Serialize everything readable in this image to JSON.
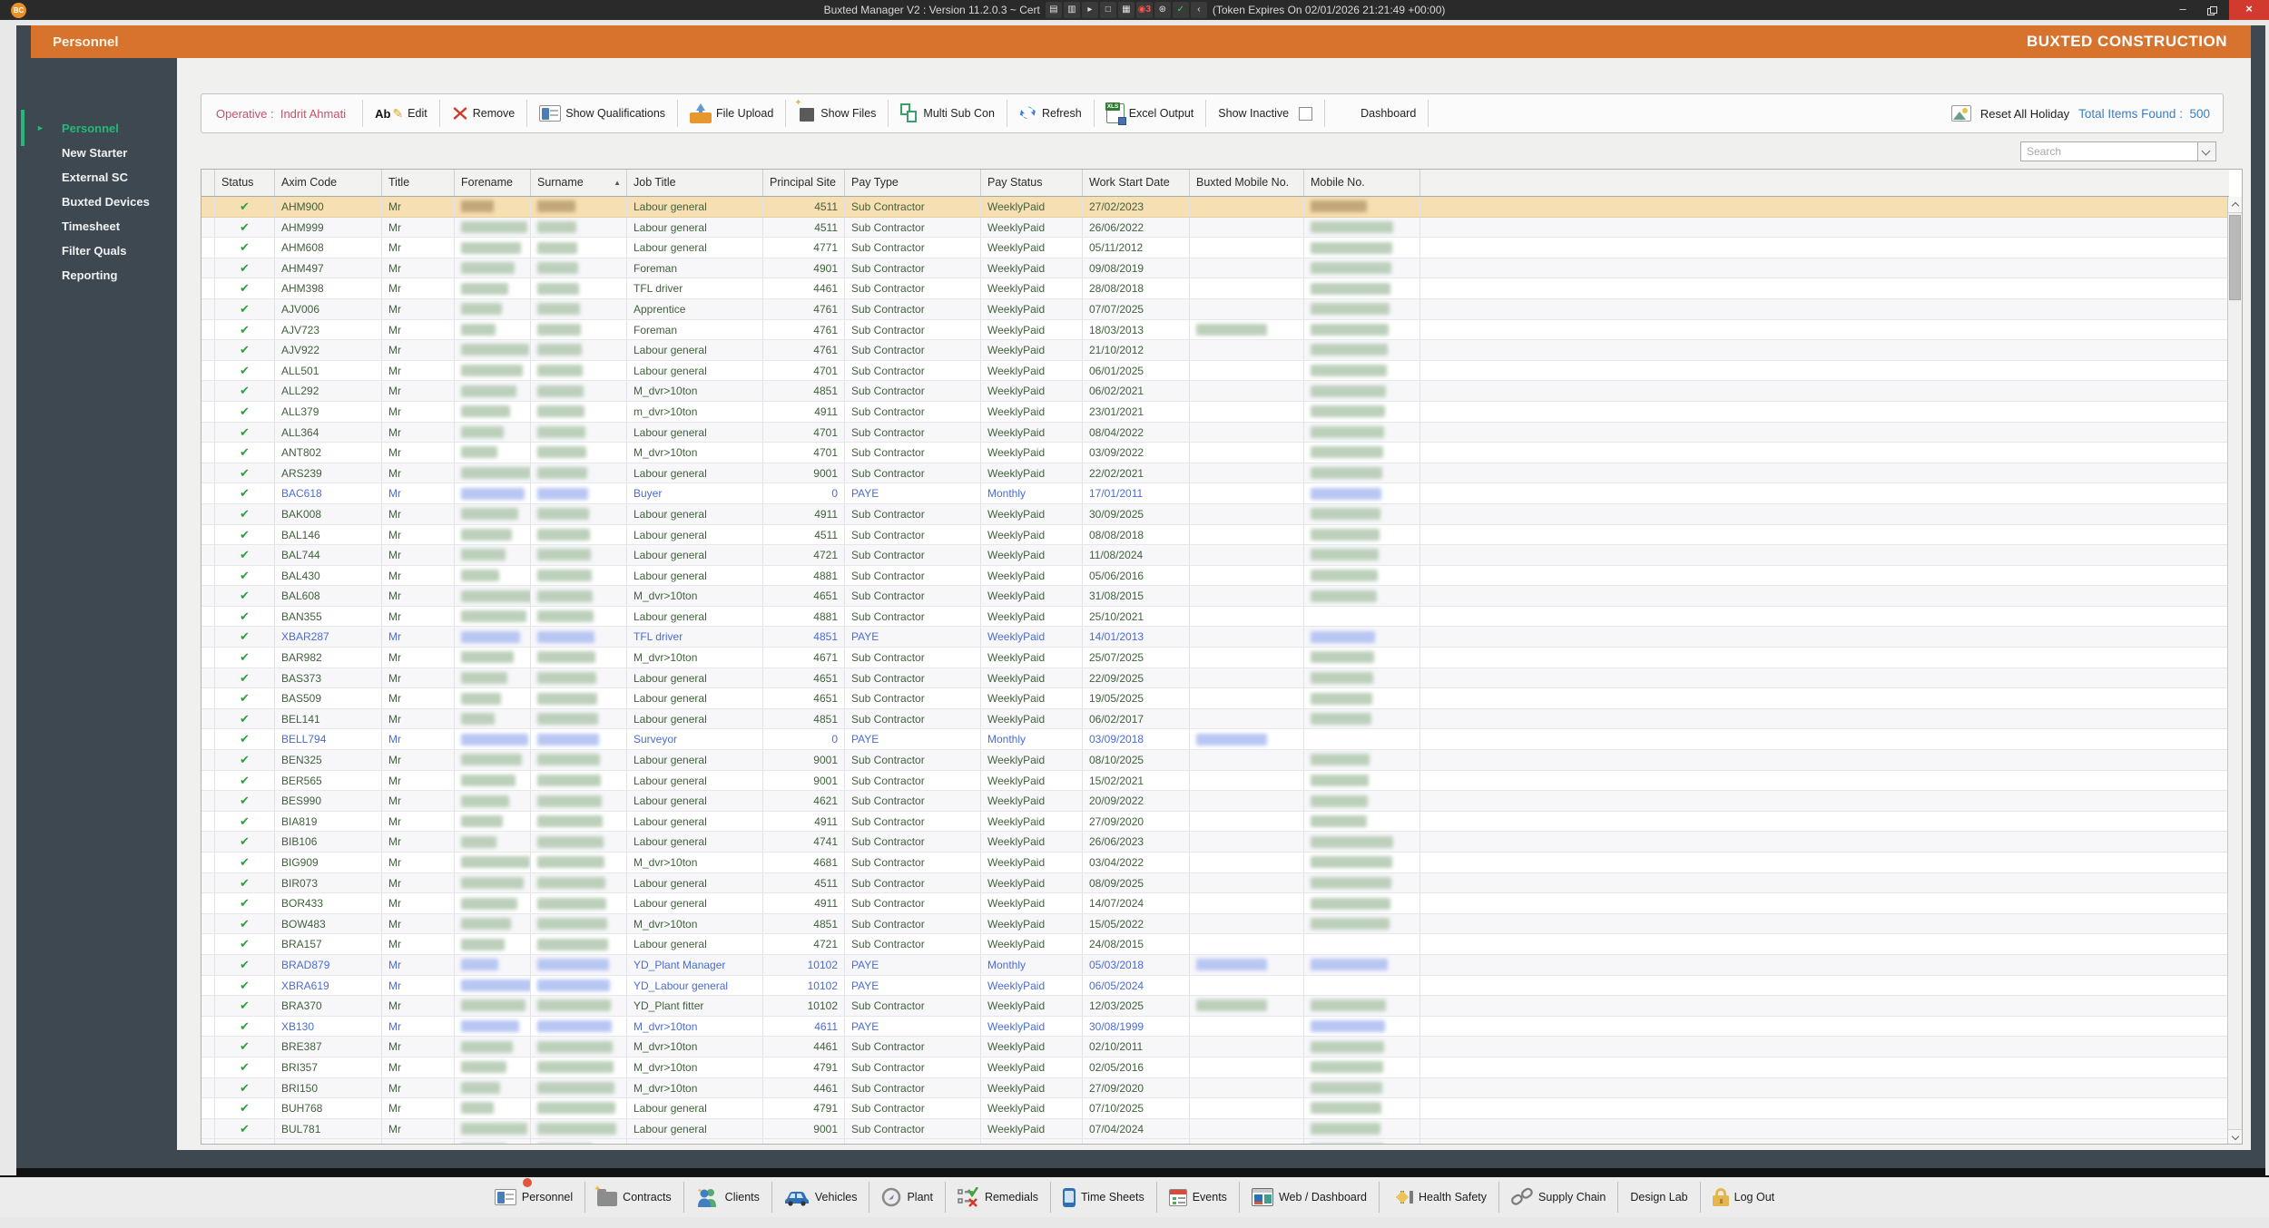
{
  "titlebar": {
    "logo": "BC",
    "title_left": "Buxted Manager V2 : Version 11.2.0.3 ~ Cert",
    "title_right": "(Token Expires On 02/01/2026 21:21:49 +00:00)",
    "tray_icons": [
      "cast-icon",
      "camera-icon",
      "cursor-icon",
      "window-icon",
      "layers-icon",
      "record-count-3-icon",
      "accessibility-icon",
      "shield-check-icon",
      "collapse-arrow-icon"
    ],
    "window_controls": {
      "minimize": "–",
      "restore": "",
      "close": "×"
    }
  },
  "header": {
    "page_title": "Personnel",
    "brand": "BUXTED CONSTRUCTION"
  },
  "sidebar": {
    "items": [
      {
        "label": "Personnel",
        "active": true
      },
      {
        "label": "New Starter",
        "active": false
      },
      {
        "label": "External SC",
        "active": false
      },
      {
        "label": "Buxted Devices",
        "active": false
      },
      {
        "label": "Timesheet",
        "active": false
      },
      {
        "label": "Filter Quals",
        "active": false
      },
      {
        "label": "Reporting",
        "active": false
      }
    ]
  },
  "toolbar": {
    "operative_label": "Operative :",
    "operative_name": "Indrit Ahmati",
    "edit_label": "Edit",
    "remove_label": "Remove",
    "show_qualifications_label": "Show Qualifications",
    "file_upload_label": "File Upload",
    "show_files_label": "Show Files",
    "multi_sub_con_label": "Multi Sub Con",
    "refresh_label": "Refresh",
    "excel_output_label": "Excel Output",
    "show_inactive_label": "Show Inactive",
    "show_inactive_checked": false,
    "dashboard_label": "Dashboard",
    "reset_all_holiday_label": "Reset All Holiday",
    "total_items_label": "Total Items Found :",
    "total_items_value": "500"
  },
  "search": {
    "placeholder": "Search"
  },
  "grid": {
    "columns": [
      {
        "label": ""
      },
      {
        "label": "Status"
      },
      {
        "label": "Axim Code"
      },
      {
        "label": "Title"
      },
      {
        "label": "Forename"
      },
      {
        "label": "Surname",
        "sorted": "asc"
      },
      {
        "label": "Job Title"
      },
      {
        "label": "Principal Site"
      },
      {
        "label": "Pay Type"
      },
      {
        "label": "Pay Status"
      },
      {
        "label": "Work Start Date"
      },
      {
        "label": "Buxted Mobile No."
      },
      {
        "label": "Mobile No."
      }
    ],
    "rows": [
      {
        "axim": "AHM900",
        "title": "Mr",
        "job": "Labour general",
        "site": "4511",
        "pay_type": "Sub Contractor",
        "pay_status": "WeeklyPaid",
        "date": "27/02/2023",
        "buxted_redacted": false,
        "mobile_redacted": true,
        "selected": true
      },
      {
        "axim": "AHM999",
        "title": "Mr",
        "job": "Labour general",
        "site": "4511",
        "pay_type": "Sub Contractor",
        "pay_status": "WeeklyPaid",
        "date": "26/06/2022",
        "buxted_redacted": false,
        "mobile_redacted": true
      },
      {
        "axim": "AHM608",
        "title": "Mr",
        "job": "Labour general",
        "site": "4771",
        "pay_type": "Sub Contractor",
        "pay_status": "WeeklyPaid",
        "date": "05/11/2012",
        "buxted_redacted": false,
        "mobile_redacted": true
      },
      {
        "axim": "AHM497",
        "title": "Mr",
        "job": "Foreman",
        "site": "4901",
        "pay_type": "Sub Contractor",
        "pay_status": "WeeklyPaid",
        "date": "09/08/2019",
        "buxted_redacted": false,
        "mobile_redacted": true
      },
      {
        "axim": "AHM398",
        "title": "Mr",
        "job": "TFL driver",
        "site": "4461",
        "pay_type": "Sub Contractor",
        "pay_status": "WeeklyPaid",
        "date": "28/08/2018",
        "buxted_redacted": false,
        "mobile_redacted": true
      },
      {
        "axim": "AJV006",
        "title": "Mr",
        "job": "Apprentice",
        "site": "4761",
        "pay_type": "Sub Contractor",
        "pay_status": "WeeklyPaid",
        "date": "07/07/2025",
        "buxted_redacted": false,
        "mobile_redacted": true
      },
      {
        "axim": "AJV723",
        "title": "Mr",
        "job": "Foreman",
        "site": "4761",
        "pay_type": "Sub Contractor",
        "pay_status": "WeeklyPaid",
        "date": "18/03/2013",
        "buxted_redacted": true,
        "mobile_redacted": true
      },
      {
        "axim": "AJV922",
        "title": "Mr",
        "job": "Labour general",
        "site": "4761",
        "pay_type": "Sub Contractor",
        "pay_status": "WeeklyPaid",
        "date": "21/10/2012",
        "buxted_redacted": false,
        "mobile_redacted": true
      },
      {
        "axim": "ALL501",
        "title": "Mr",
        "job": "Labour general",
        "site": "4701",
        "pay_type": "Sub Contractor",
        "pay_status": "WeeklyPaid",
        "date": "06/01/2025",
        "buxted_redacted": false,
        "mobile_redacted": true
      },
      {
        "axim": "ALL292",
        "title": "Mr",
        "job": "M_dvr>10ton",
        "site": "4851",
        "pay_type": "Sub Contractor",
        "pay_status": "WeeklyPaid",
        "date": "06/02/2021",
        "buxted_redacted": false,
        "mobile_redacted": true
      },
      {
        "axim": "ALL379",
        "title": "Mr",
        "job": "m_dvr>10ton",
        "site": "4911",
        "pay_type": "Sub Contractor",
        "pay_status": "WeeklyPaid",
        "date": "23/01/2021",
        "buxted_redacted": false,
        "mobile_redacted": true
      },
      {
        "axim": "ALL364",
        "title": "Mr",
        "job": "Labour general",
        "site": "4701",
        "pay_type": "Sub Contractor",
        "pay_status": "WeeklyPaid",
        "date": "08/04/2022",
        "buxted_redacted": false,
        "mobile_redacted": true
      },
      {
        "axim": "ANT802",
        "title": "Mr",
        "job": "M_dvr>10ton",
        "site": "4701",
        "pay_type": "Sub Contractor",
        "pay_status": "WeeklyPaid",
        "date": "03/09/2022",
        "buxted_redacted": false,
        "mobile_redacted": true
      },
      {
        "axim": "ARS239",
        "title": "Mr",
        "job": "Labour general",
        "site": "9001",
        "pay_type": "Sub Contractor",
        "pay_status": "WeeklyPaid",
        "date": "22/02/2021",
        "buxted_redacted": false,
        "mobile_redacted": true
      },
      {
        "axim": "BAC618",
        "title": "Mr",
        "job": "Buyer",
        "site": "0",
        "pay_type": "PAYE",
        "pay_status": "Monthly",
        "date": "17/01/2011",
        "buxted_redacted": false,
        "mobile_redacted": true
      },
      {
        "axim": "BAK008",
        "title": "Mr",
        "job": "Labour general",
        "site": "4911",
        "pay_type": "Sub Contractor",
        "pay_status": "WeeklyPaid",
        "date": "30/09/2025",
        "buxted_redacted": false,
        "mobile_redacted": true
      },
      {
        "axim": "BAL146",
        "title": "Mr",
        "job": "Labour general",
        "site": "4511",
        "pay_type": "Sub Contractor",
        "pay_status": "WeeklyPaid",
        "date": "08/08/2018",
        "buxted_redacted": false,
        "mobile_redacted": true
      },
      {
        "axim": "BAL744",
        "title": "Mr",
        "job": "Labour general",
        "site": "4721",
        "pay_type": "Sub Contractor",
        "pay_status": "WeeklyPaid",
        "date": "11/08/2024",
        "buxted_redacted": false,
        "mobile_redacted": true
      },
      {
        "axim": "BAL430",
        "title": "Mr",
        "job": "Labour general",
        "site": "4881",
        "pay_type": "Sub Contractor",
        "pay_status": "WeeklyPaid",
        "date": "05/06/2016",
        "buxted_redacted": false,
        "mobile_redacted": true
      },
      {
        "axim": "BAL608",
        "title": "Mr",
        "job": "M_dvr>10ton",
        "site": "4651",
        "pay_type": "Sub Contractor",
        "pay_status": "WeeklyPaid",
        "date": "31/08/2015",
        "buxted_redacted": false,
        "mobile_redacted": true
      },
      {
        "axim": "BAN355",
        "title": "Mr",
        "job": "Labour general",
        "site": "4881",
        "pay_type": "Sub Contractor",
        "pay_status": "WeeklyPaid",
        "date": "25/10/2021",
        "buxted_redacted": false,
        "mobile_redacted": false
      },
      {
        "axim": "XBAR287",
        "title": "Mr",
        "job": "TFL driver",
        "site": "4851",
        "pay_type": "PAYE",
        "pay_status": "WeeklyPaid",
        "date": "14/01/2013",
        "buxted_redacted": false,
        "mobile_redacted": true
      },
      {
        "axim": "BAR982",
        "title": "Mr",
        "job": "M_dvr>10ton",
        "site": "4671",
        "pay_type": "Sub Contractor",
        "pay_status": "WeeklyPaid",
        "date": "25/07/2025",
        "buxted_redacted": false,
        "mobile_redacted": true
      },
      {
        "axim": "BAS373",
        "title": "Mr",
        "job": "Labour general",
        "site": "4651",
        "pay_type": "Sub Contractor",
        "pay_status": "WeeklyPaid",
        "date": "22/09/2025",
        "buxted_redacted": false,
        "mobile_redacted": true
      },
      {
        "axim": "BAS509",
        "title": "Mr",
        "job": "Labour general",
        "site": "4651",
        "pay_type": "Sub Contractor",
        "pay_status": "WeeklyPaid",
        "date": "19/05/2025",
        "buxted_redacted": false,
        "mobile_redacted": true
      },
      {
        "axim": "BEL141",
        "title": "Mr",
        "job": "Labour general",
        "site": "4851",
        "pay_type": "Sub Contractor",
        "pay_status": "WeeklyPaid",
        "date": "06/02/2017",
        "buxted_redacted": false,
        "mobile_redacted": true
      },
      {
        "axim": "BELL794",
        "title": "Mr",
        "job": "Surveyor",
        "site": "0",
        "pay_type": "PAYE",
        "pay_status": "Monthly",
        "date": "03/09/2018",
        "buxted_redacted": true,
        "mobile_redacted": false
      },
      {
        "axim": "BEN325",
        "title": "Mr",
        "job": "Labour general",
        "site": "9001",
        "pay_type": "Sub Contractor",
        "pay_status": "WeeklyPaid",
        "date": "08/10/2025",
        "buxted_redacted": false,
        "mobile_redacted": true
      },
      {
        "axim": "BER565",
        "title": "Mr",
        "job": "Labour general",
        "site": "9001",
        "pay_type": "Sub Contractor",
        "pay_status": "WeeklyPaid",
        "date": "15/02/2021",
        "buxted_redacted": false,
        "mobile_redacted": true
      },
      {
        "axim": "BES990",
        "title": "Mr",
        "job": "Labour general",
        "site": "4621",
        "pay_type": "Sub Contractor",
        "pay_status": "WeeklyPaid",
        "date": "20/09/2022",
        "buxted_redacted": false,
        "mobile_redacted": true
      },
      {
        "axim": "BIA819",
        "title": "Mr",
        "job": "Labour general",
        "site": "4911",
        "pay_type": "Sub Contractor",
        "pay_status": "WeeklyPaid",
        "date": "27/09/2020",
        "buxted_redacted": false,
        "mobile_redacted": true
      },
      {
        "axim": "BIB106",
        "title": "Mr",
        "job": "Labour general",
        "site": "4741",
        "pay_type": "Sub Contractor",
        "pay_status": "WeeklyPaid",
        "date": "26/06/2023",
        "buxted_redacted": false,
        "mobile_redacted": true
      },
      {
        "axim": "BIG909",
        "title": "Mr",
        "job": "M_dvr>10ton",
        "site": "4681",
        "pay_type": "Sub Contractor",
        "pay_status": "WeeklyPaid",
        "date": "03/04/2022",
        "buxted_redacted": false,
        "mobile_redacted": true
      },
      {
        "axim": "BIR073",
        "title": "Mr",
        "job": "Labour general",
        "site": "4511",
        "pay_type": "Sub Contractor",
        "pay_status": "WeeklyPaid",
        "date": "08/09/2025",
        "buxted_redacted": false,
        "mobile_redacted": true
      },
      {
        "axim": "BOR433",
        "title": "Mr",
        "job": "Labour general",
        "site": "4911",
        "pay_type": "Sub Contractor",
        "pay_status": "WeeklyPaid",
        "date": "14/07/2024",
        "buxted_redacted": false,
        "mobile_redacted": true
      },
      {
        "axim": "BOW483",
        "title": "Mr",
        "job": "M_dvr>10ton",
        "site": "4851",
        "pay_type": "Sub Contractor",
        "pay_status": "WeeklyPaid",
        "date": "15/05/2022",
        "buxted_redacted": false,
        "mobile_redacted": true
      },
      {
        "axim": "BRA157",
        "title": "Mr",
        "job": "Labour general",
        "site": "4721",
        "pay_type": "Sub Contractor",
        "pay_status": "WeeklyPaid",
        "date": "24/08/2015",
        "buxted_redacted": false,
        "mobile_redacted": false
      },
      {
        "axim": "BRAD879",
        "title": "Mr",
        "job": "YD_Plant Manager",
        "site": "10102",
        "pay_type": "PAYE",
        "pay_status": "Monthly",
        "date": "05/03/2018",
        "buxted_redacted": true,
        "mobile_redacted": true
      },
      {
        "axim": "XBRA619",
        "title": "Mr",
        "job": "YD_Labour general",
        "site": "10102",
        "pay_type": "PAYE",
        "pay_status": "WeeklyPaid",
        "date": "06/05/2024",
        "buxted_redacted": false,
        "mobile_redacted": false
      },
      {
        "axim": "BRA370",
        "title": "Mr",
        "job": "YD_Plant fitter",
        "site": "10102",
        "pay_type": "Sub Contractor",
        "pay_status": "WeeklyPaid",
        "date": "12/03/2025",
        "buxted_redacted": true,
        "mobile_redacted": true
      },
      {
        "axim": "XB130",
        "title": "Mr",
        "job": "M_dvr>10ton",
        "site": "4611",
        "pay_type": "PAYE",
        "pay_status": "WeeklyPaid",
        "date": "30/08/1999",
        "buxted_redacted": false,
        "mobile_redacted": true
      },
      {
        "axim": "BRE387",
        "title": "Mr",
        "job": "M_dvr>10ton",
        "site": "4461",
        "pay_type": "Sub Contractor",
        "pay_status": "WeeklyPaid",
        "date": "02/10/2011",
        "buxted_redacted": false,
        "mobile_redacted": true
      },
      {
        "axim": "BRI357",
        "title": "Mr",
        "job": "M_dvr>10ton",
        "site": "4791",
        "pay_type": "Sub Contractor",
        "pay_status": "WeeklyPaid",
        "date": "02/05/2016",
        "buxted_redacted": false,
        "mobile_redacted": true
      },
      {
        "axim": "BRI150",
        "title": "Mr",
        "job": "M_dvr>10ton",
        "site": "4461",
        "pay_type": "Sub Contractor",
        "pay_status": "WeeklyPaid",
        "date": "27/09/2020",
        "buxted_redacted": false,
        "mobile_redacted": true
      },
      {
        "axim": "BUH768",
        "title": "Mr",
        "job": "Labour general",
        "site": "4791",
        "pay_type": "Sub Contractor",
        "pay_status": "WeeklyPaid",
        "date": "07/10/2025",
        "buxted_redacted": false,
        "mobile_redacted": true
      },
      {
        "axim": "BUL781",
        "title": "Mr",
        "job": "Labour general",
        "site": "9001",
        "pay_type": "Sub Contractor",
        "pay_status": "WeeklyPaid",
        "date": "07/04/2024",
        "buxted_redacted": false,
        "mobile_redacted": true
      }
    ]
  },
  "taskbar": {
    "items": [
      {
        "label": "Personnel",
        "badge": true
      },
      {
        "label": "Contracts"
      },
      {
        "label": "Clients"
      },
      {
        "label": "Vehicles"
      },
      {
        "label": "Plant"
      },
      {
        "label": "Remedials"
      },
      {
        "label": "Time Sheets"
      },
      {
        "label": "Events"
      },
      {
        "label": "Web / Dashboard"
      },
      {
        "label": "Health Safety"
      },
      {
        "label": "Supply Chain"
      },
      {
        "label": "Design Lab"
      },
      {
        "label": "Log Out"
      }
    ]
  },
  "colors": {
    "accent_orange": "#d8732e",
    "sidebar_active_green": "#25b878",
    "row_text_green": "#41603c",
    "paye_blue": "#4a6cd4",
    "selected_row_bg": "#f6dfb2",
    "total_items_blue": "#3b7fc4",
    "operative_pink": "#c25569"
  }
}
